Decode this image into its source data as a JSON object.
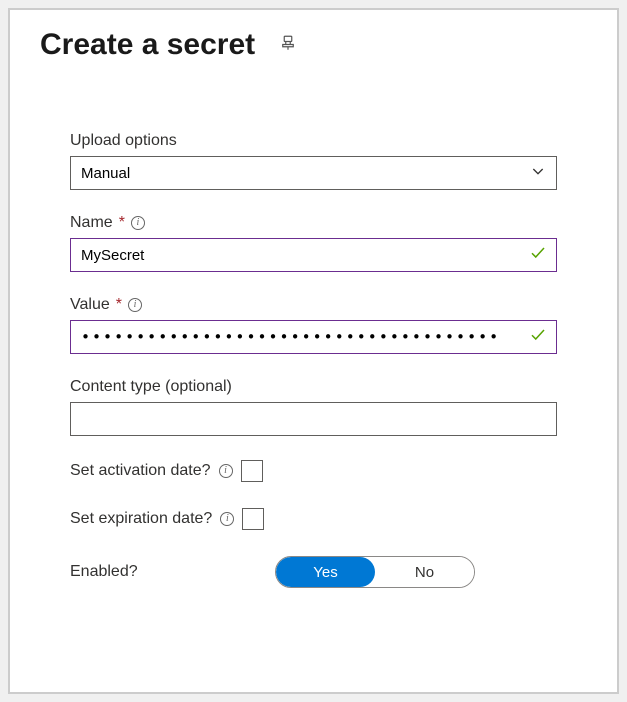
{
  "header": {
    "title": "Create a secret"
  },
  "form": {
    "uploadOptions": {
      "label": "Upload options",
      "value": "Manual"
    },
    "name": {
      "label": "Name",
      "required": "*",
      "value": "MySecret"
    },
    "value": {
      "label": "Value",
      "required": "*",
      "masked": "••••••••••••••••••••••••••••••••••••••"
    },
    "contentType": {
      "label": "Content type (optional)",
      "value": ""
    },
    "activation": {
      "label": "Set activation date?",
      "checked": false
    },
    "expiration": {
      "label": "Set expiration date?",
      "checked": false
    },
    "enabled": {
      "label": "Enabled?",
      "yes": "Yes",
      "no": "No",
      "selected": "yes"
    }
  }
}
